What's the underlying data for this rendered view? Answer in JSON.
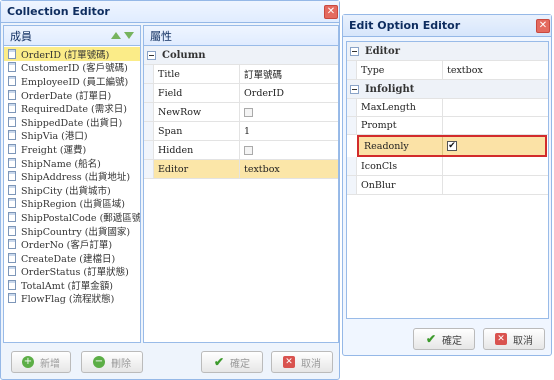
{
  "collection_editor": {
    "title": "Collection Editor",
    "members_header": "成員",
    "properties_header": "屬性",
    "members": [
      "OrderID (訂單號碼)",
      "CustomerID (客戶號碼)",
      "EmployeeID (員工編號)",
      "OrderDate (訂單日)",
      "RequiredDate (需求日)",
      "ShippedDate (出貨日)",
      "ShipVia (港口)",
      "Freight (運費)",
      "ShipName (船名)",
      "ShipAddress (出貨地址)",
      "ShipCity (出貨城市)",
      "ShipRegion (出貨區域)",
      "ShipPostalCode (郵遞區號)",
      "ShipCountry (出貨國家)",
      "OrderNo (客戶訂單)",
      "CreateDate (建檔日)",
      "OrderStatus (訂單狀態)",
      "TotalAmt (訂單金額)",
      "FlowFlag (流程狀態)"
    ],
    "property_group": "Column",
    "properties": {
      "title": {
        "name": "Title",
        "value": "訂單號碼"
      },
      "field": {
        "name": "Field",
        "value": "OrderID"
      },
      "newrow": {
        "name": "NewRow",
        "checked": false
      },
      "span": {
        "name": "Span",
        "value": "1"
      },
      "hidden": {
        "name": "Hidden",
        "checked": false
      },
      "editor": {
        "name": "Editor",
        "value": "textbox"
      }
    },
    "buttons": {
      "add": "新增",
      "delete": "刪除",
      "ok": "確定",
      "cancel": "取消"
    }
  },
  "option_editor": {
    "title": "Edit Option Editor",
    "groups": {
      "editor": "Editor",
      "infolight": "Infolight"
    },
    "type_row": {
      "name": "Type",
      "value": "textbox"
    },
    "rows": {
      "maxlength": "MaxLength",
      "prompt": "Prompt",
      "readonly": "Readonly",
      "iconcls": "IconCls",
      "onblur": "OnBlur"
    },
    "readonly_checked": true,
    "buttons": {
      "ok": "確定",
      "cancel": "取消"
    }
  },
  "colors": {
    "selected_row": "#fbec88",
    "highlight_border": "#d22b2b",
    "panel_border": "#99bbe8"
  }
}
